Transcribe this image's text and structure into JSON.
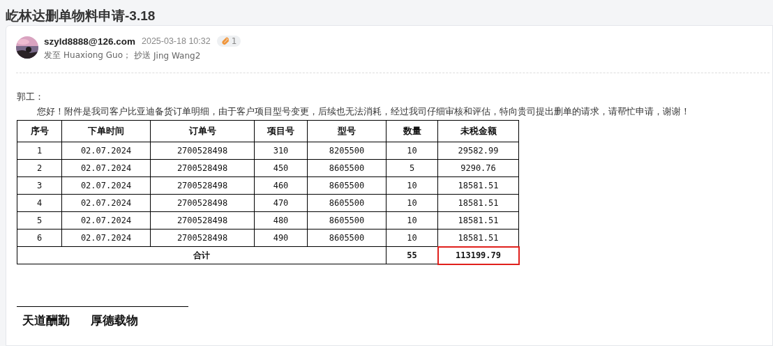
{
  "title": "屹林达删单物料申请-3.18",
  "message": {
    "sender": "szyld8888@126.com",
    "time": "2025-03-18 10:32",
    "attachments": "1",
    "recipients_label": "发至",
    "recipients": "Huaxiong Guo；",
    "cc_label": "抄送",
    "cc": "Jing Wang2"
  },
  "greeting": "郭工：",
  "paragraph": "您好！附件是我司客户比亚迪备货订单明细，由于客户项目型号变更，后续也无法消耗，经过我司仔细审核和评估，特向贵司提出删单的请求，请帮忙申请，谢谢！",
  "table": {
    "columns": [
      "序号",
      "下单时间",
      "订单号",
      "项目号",
      "型号",
      "数量",
      "未税金额"
    ],
    "rows": [
      [
        "1",
        "02.07.2024",
        "2700528498",
        "310",
        "8205500",
        "10",
        "29582.99"
      ],
      [
        "2",
        "02.07.2024",
        "2700528498",
        "450",
        "8605500",
        "5",
        "9290.76"
      ],
      [
        "3",
        "02.07.2024",
        "2700528498",
        "460",
        "8605500",
        "10",
        "18581.51"
      ],
      [
        "4",
        "02.07.2024",
        "2700528498",
        "470",
        "8605500",
        "10",
        "18581.51"
      ],
      [
        "5",
        "02.07.2024",
        "2700528498",
        "480",
        "8605500",
        "10",
        "18581.51"
      ],
      [
        "6",
        "02.07.2024",
        "2700528498",
        "490",
        "8605500",
        "10",
        "18581.51"
      ]
    ],
    "total": {
      "label": "合计",
      "quantity": "55",
      "amount": "113199.79",
      "highlighted": true
    }
  },
  "signature": [
    "天道酬勤",
    "厚德载物"
  ]
}
